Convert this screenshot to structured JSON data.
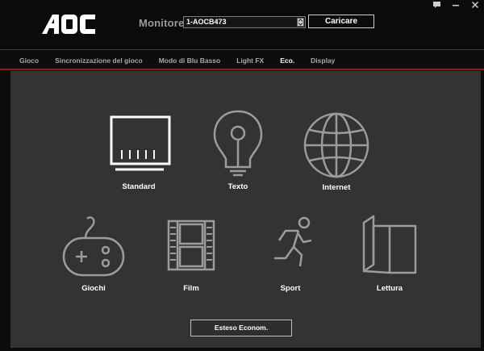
{
  "header": {
    "logo_text": "AOC",
    "monitor_label": "Monitore",
    "monitor_value": "1-AOCB473",
    "load_button": "Caricare"
  },
  "window_controls": [
    "chat-icon",
    "minimize-icon",
    "close-icon"
  ],
  "tabs": [
    {
      "label": "Gioco",
      "active": false
    },
    {
      "label": "Sincronizzazione del gioco",
      "active": false
    },
    {
      "label": "Modo di Blu Basso",
      "active": false
    },
    {
      "label": "Light FX",
      "active": false
    },
    {
      "label": "Eco.",
      "active": true
    },
    {
      "label": "Display",
      "active": false
    }
  ],
  "modes": [
    {
      "label": "Standard",
      "icon": "monitor-icon",
      "selected": true
    },
    {
      "label": "Texto",
      "icon": "lightbulb-icon",
      "selected": false
    },
    {
      "label": "Internet",
      "icon": "globe-icon",
      "selected": false
    },
    {
      "label": "Giochi",
      "icon": "gamepad-icon",
      "selected": false
    },
    {
      "label": "Film",
      "icon": "film-icon",
      "selected": false
    },
    {
      "label": "Sport",
      "icon": "runner-icon",
      "selected": false
    },
    {
      "label": "Lettura",
      "icon": "book-icon",
      "selected": false
    }
  ],
  "eco_button": "Esteso Econom.",
  "colors": {
    "accent_red": "#8a1b22",
    "panel_bg": "#333333",
    "icon_gray": "#9c9c9c",
    "icon_selected": "#ffffff"
  }
}
